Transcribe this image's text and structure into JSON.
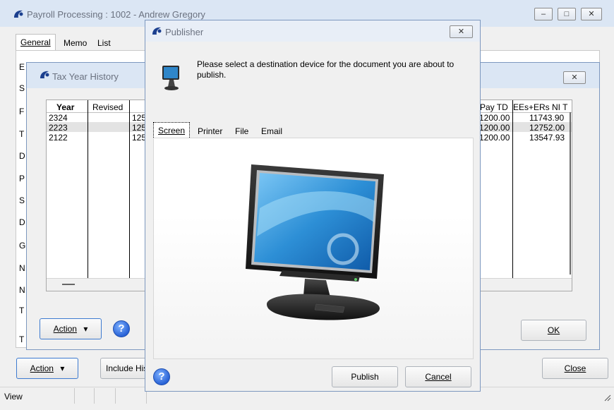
{
  "main_window": {
    "title": "Payroll Processing : 1002 - Andrew Gregory",
    "tabs": [
      "General",
      "Memo",
      "List"
    ],
    "left_letters": [
      "E",
      "S",
      "F",
      "T",
      "D",
      "P",
      "S",
      "D",
      "G",
      "N",
      "N",
      "T",
      "T"
    ],
    "action_label": "Action",
    "include_label": "Include His",
    "close_label": "Close",
    "status_text": "View"
  },
  "tax_history": {
    "title": "Tax Year History",
    "columns": [
      "Year",
      "Revised",
      "Pay TD",
      "EEs+ERs NI T"
    ],
    "rows": [
      {
        "year": "2324",
        "partial": "125",
        "pay": "1200.00",
        "ni": "11743.90"
      },
      {
        "year": "2223",
        "partial": "125",
        "pay": "1200.00",
        "ni": "12752.00"
      },
      {
        "year": "2122",
        "partial": "125",
        "pay": "1200.00",
        "ni": "13547.93"
      }
    ],
    "action_label": "Action",
    "ok_label": "OK"
  },
  "publisher": {
    "title": "Publisher",
    "message": "Please select a destination device for the document you are about to publish.",
    "tabs": [
      "Screen",
      "Printer",
      "File",
      "Email"
    ],
    "publish_label": "Publish",
    "cancel_label": "Cancel",
    "close_glyph": "✕"
  },
  "glyphs": {
    "help": "?",
    "dropdown": "▾",
    "minimize": "–",
    "maximize": "□",
    "close": "✕"
  }
}
